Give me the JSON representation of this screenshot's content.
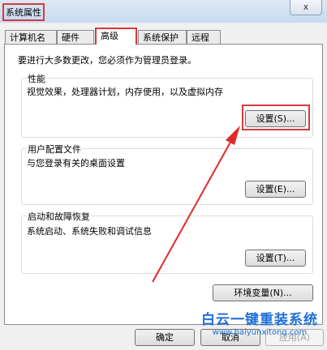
{
  "window": {
    "title": "系统属性",
    "close_label": "x"
  },
  "tabs": [
    {
      "label": "计算机名"
    },
    {
      "label": "硬件"
    },
    {
      "label": "高级"
    },
    {
      "label": "系统保护"
    },
    {
      "label": "远程"
    }
  ],
  "active_tab": "高级",
  "intro": "要进行大多数更改，您必须作为管理员登录。",
  "performance": {
    "title": "性能",
    "description": "视觉效果，处理器计划，内存使用，以及虚拟内存",
    "settings_label": "设置(S)..."
  },
  "user_profiles": {
    "title": "用户配置文件",
    "description": "与您登录有关的桌面设置",
    "settings_label": "设置(E)..."
  },
  "startup_recovery": {
    "title": "启动和故障恢复",
    "description": "系统启动、系统失败和调试信息",
    "settings_label": "设置(T)..."
  },
  "env_vars_label": "环境变量(N)...",
  "footer": {
    "ok_label": "确定",
    "cancel_label": "取消",
    "apply_label": "应用(A)"
  },
  "watermark": {
    "title": "白云一键重装系统",
    "url": "www.baiyunxitong.com"
  },
  "colors": {
    "highlight": "#d83a3a",
    "watermark": "#1f6fd6"
  }
}
